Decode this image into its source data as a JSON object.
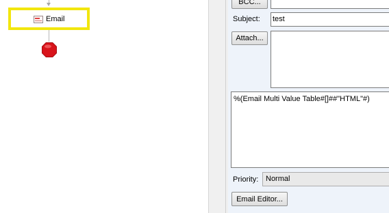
{
  "canvas": {
    "email_node_label": "Email",
    "stop_node_color": "#d8141b"
  },
  "panel": {
    "bcc_button": "BCC...",
    "bcc_value": "",
    "subject_label_prefix": "S",
    "subject_label_rest": "ubject:",
    "subject_value": "test",
    "attach_button": "Attach...",
    "body_value": "%(Email Multi Value Table#[]##\"HTML\"#)",
    "priority_label_prefix": "P",
    "priority_label_rest": "riority:",
    "priority_value": "Normal",
    "email_editor_button": "Email Editor..."
  },
  "colors": {
    "highlight": "#f2e60e",
    "panel_bg": "#eef3fa"
  }
}
